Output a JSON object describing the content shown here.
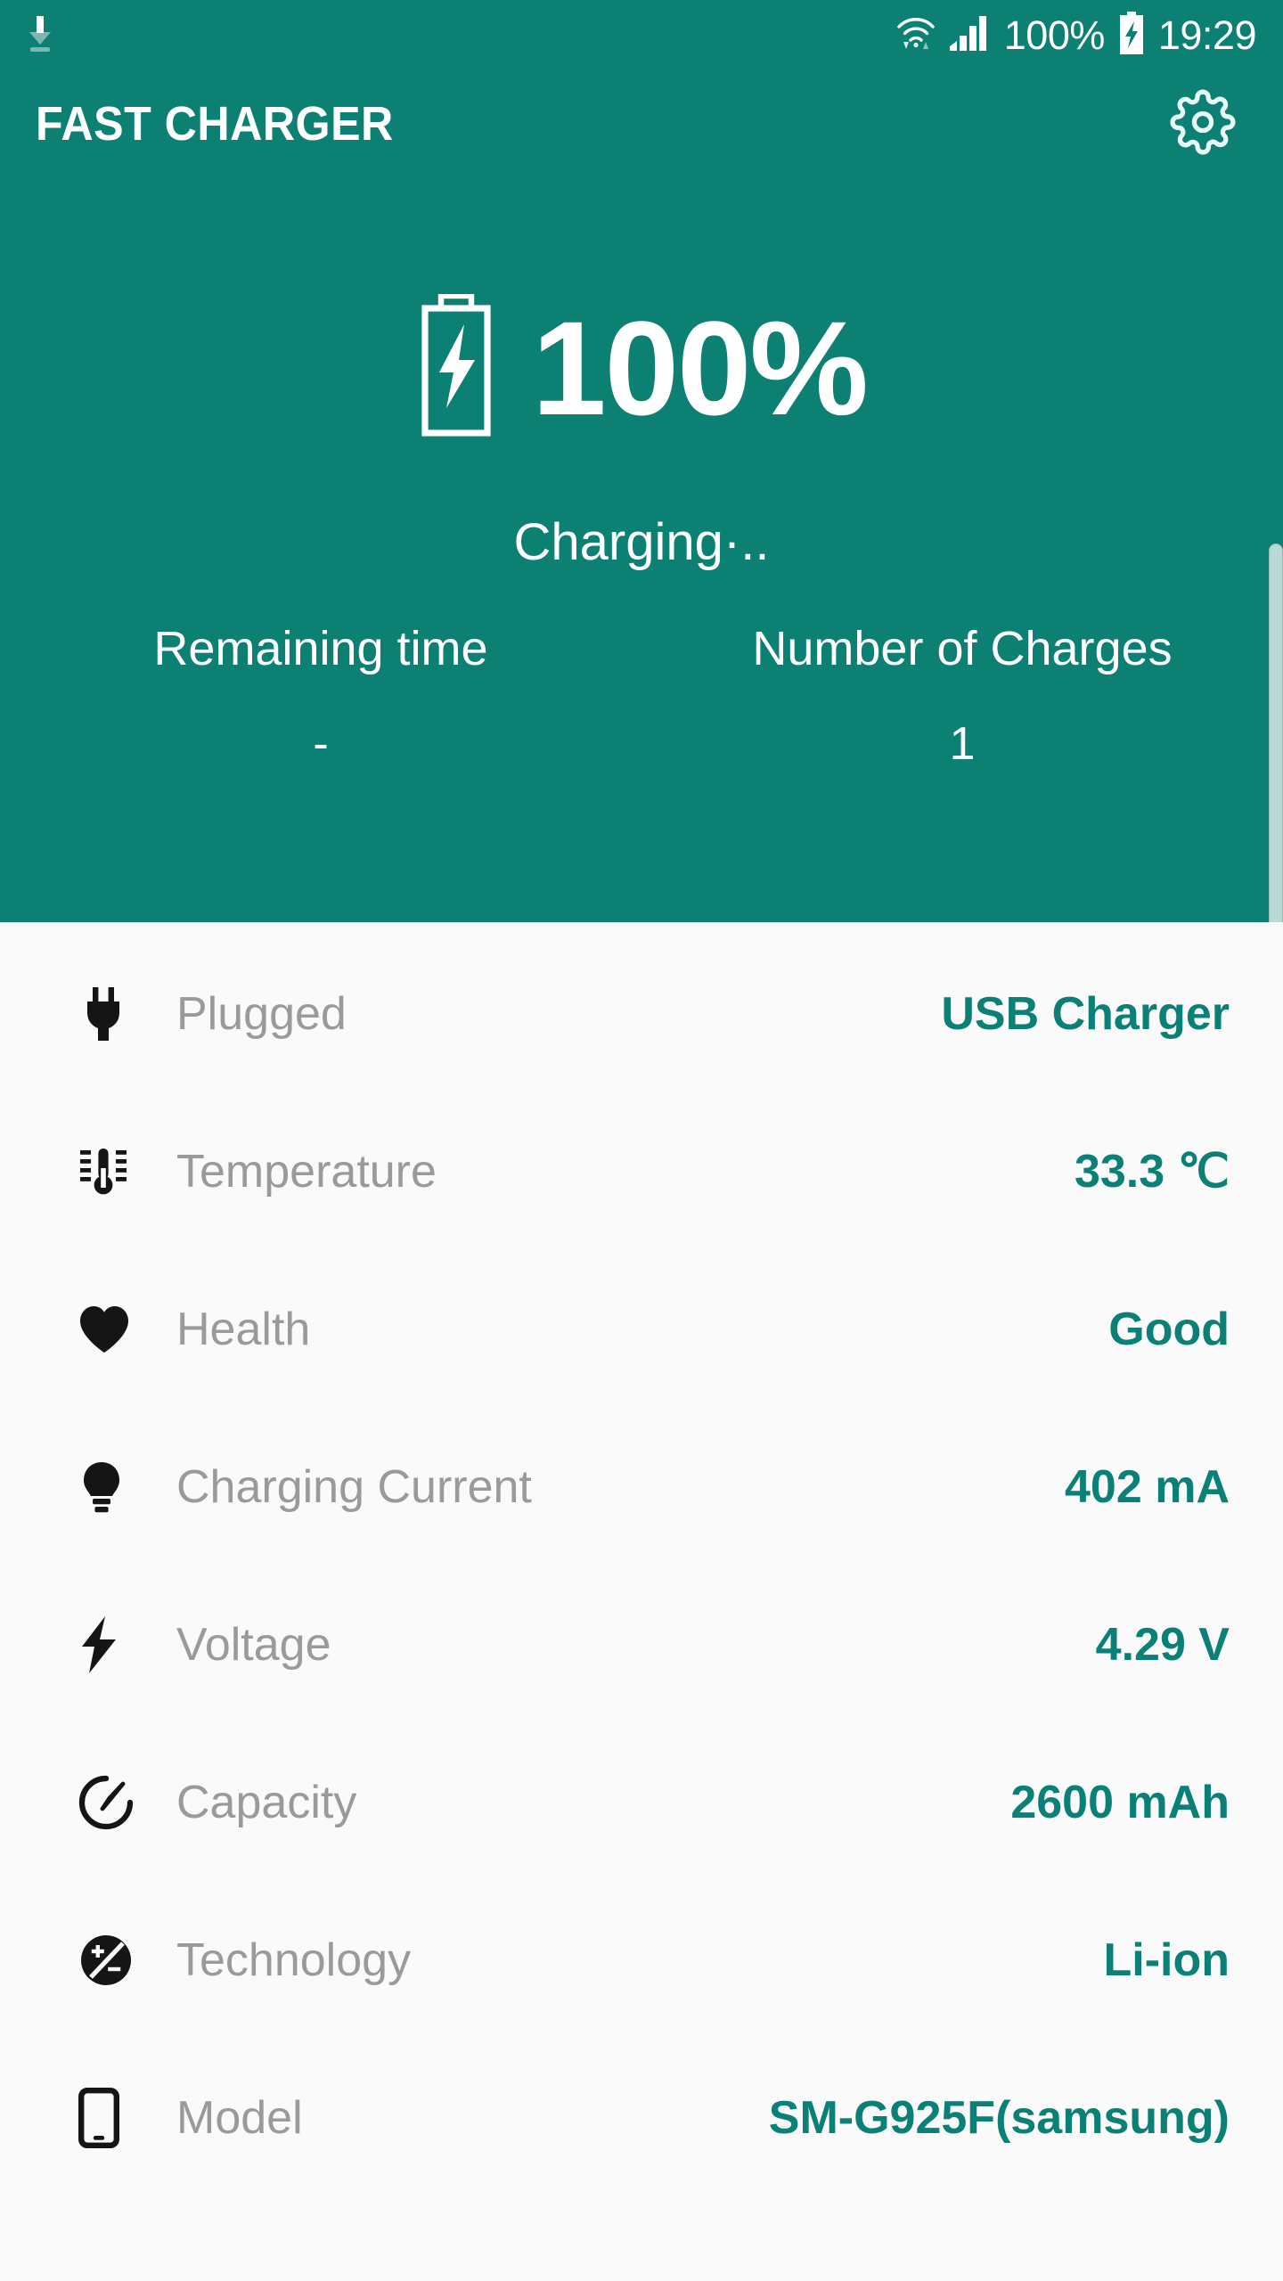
{
  "statusbar": {
    "download_icon": "download-icon",
    "wifi_icon": "wifi-icon",
    "signal_icon": "cellular-signal-icon",
    "battery_percent": "100%",
    "battery_icon": "battery-charging-icon",
    "time": "19:29"
  },
  "appbar": {
    "title": "FAST CHARGER",
    "settings_icon": "gear-icon"
  },
  "hero": {
    "battery_icon": "battery-bolt-icon",
    "percent": "100%",
    "status": "Charging·..",
    "stats": [
      {
        "label": "Remaining time",
        "value": "-"
      },
      {
        "label": "Number of Charges",
        "value": "1"
      }
    ]
  },
  "details": {
    "rows": [
      {
        "icon": "plug-icon",
        "label": "Plugged",
        "value": "USB Charger"
      },
      {
        "icon": "thermometer-icon",
        "label": "Temperature",
        "value": "33.3 ℃"
      },
      {
        "icon": "heart-icon",
        "label": "Health",
        "value": "Good"
      },
      {
        "icon": "lightbulb-icon",
        "label": "Charging Current",
        "value": "402 mA"
      },
      {
        "icon": "bolt-icon",
        "label": "Voltage",
        "value": "4.29 V"
      },
      {
        "icon": "gauge-icon",
        "label": "Capacity",
        "value": "2600 mAh"
      },
      {
        "icon": "polarity-icon",
        "label": "Technology",
        "value": "Li-ion"
      },
      {
        "icon": "phone-icon",
        "label": "Model",
        "value": "SM-G925F(samsung)"
      }
    ]
  },
  "colors": {
    "brand_teal": "#0d8074",
    "value_teal": "#0b8077",
    "label_gray": "#9a9a9a",
    "list_bg": "#fafafa"
  },
  "scrollbar": {
    "present": "true"
  }
}
